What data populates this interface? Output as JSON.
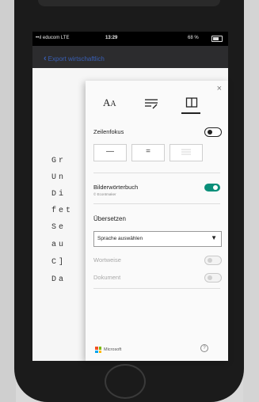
{
  "status_bar": {
    "carrier": "••ıl educom  LTE",
    "time": "13:29",
    "battery": "68 %"
  },
  "nav": {
    "back_label": "Export wirtschaftlich"
  },
  "reader": {
    "lines": [
      "Gr",
      "Un",
      "Di",
      "fet",
      "Se",
      "au",
      "C]",
      "Da"
    ]
  },
  "panel": {
    "close": "×",
    "toolbar": {
      "text_options_icon": "font-size-icon",
      "grammar_options_icon": "grammar-options-icon",
      "reading_preferences_icon": "book-icon",
      "selected": "reading_preferences"
    },
    "line_focus": {
      "label": "Zeilenfokus",
      "enabled": false,
      "options": [
        "—",
        "="
      ]
    },
    "picture_dictionary": {
      "label": "Bilderwörterbuch",
      "credit": "© Econtmaker",
      "enabled": true
    },
    "translate": {
      "heading": "Übersetzen",
      "select_value": "Sprache auswählen",
      "word_label": "Wortweise",
      "document_label": "Dokument"
    },
    "footer": {
      "brand": "Microsoft",
      "help": "?"
    }
  },
  "colors": {
    "accent": "#0a8f7a",
    "link": "#3d6fe0"
  }
}
